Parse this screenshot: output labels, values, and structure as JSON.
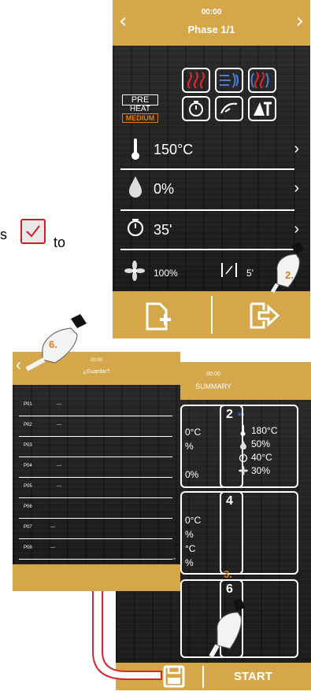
{
  "fragment": {
    "left_text": "s",
    "right_text": "to"
  },
  "phase_screen": {
    "time": "00:00",
    "title": "Phase 1/1",
    "preheat": {
      "line1": "PRE",
      "line2": "HEAT",
      "line3": "MEDIUM"
    },
    "temperature": "150°C",
    "humidity": "0%",
    "timer": "35'",
    "fan_speed": "100%",
    "delay": "5'"
  },
  "summary_screen": {
    "time": "00:00",
    "title": "SUMMARY",
    "cards": [
      {
        "num": "",
        "lines": [
          "0°C",
          "%",
          "",
          "0%"
        ]
      },
      {
        "num": "2",
        "lines": [
          "180°C",
          "50%",
          "40°C",
          "30%"
        ]
      },
      {
        "num": "",
        "lines": [
          "0°C",
          "%",
          "°C",
          "%"
        ]
      },
      {
        "num": "4",
        "lines": []
      },
      {
        "num": "",
        "lines": []
      },
      {
        "num": "6",
        "lines": []
      }
    ],
    "start_label": "START"
  },
  "save_screen": {
    "time": "00:00",
    "title": "¿Guardar?",
    "slots": [
      {
        "label": "P01",
        "value": "---"
      },
      {
        "label": "P02",
        "value": "---"
      },
      {
        "label": "P03",
        "value": ""
      },
      {
        "label": "P04",
        "value": "---"
      },
      {
        "label": "P05",
        "value": "---"
      },
      {
        "label": "P06",
        "value": ""
      },
      {
        "label": "P07",
        "value": "---"
      },
      {
        "label": "P08",
        "value": "---"
      }
    ]
  },
  "steps": {
    "step2": "2.",
    "step3": "3.",
    "step6": "6."
  },
  "colors": {
    "gold": "#d4a74a",
    "red": "#e0262c",
    "blue": "#4c7ed9",
    "orange_label": "#e07c14"
  }
}
